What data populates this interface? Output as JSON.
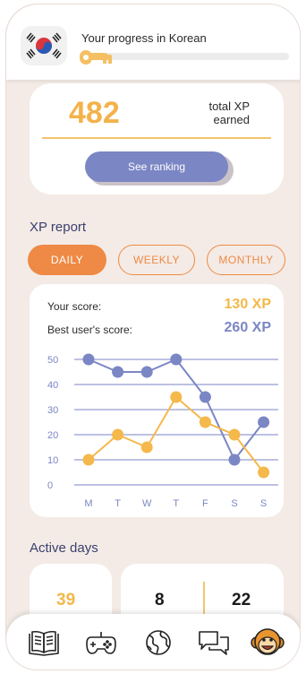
{
  "header": {
    "flag_icon": "south-korea-flag-icon",
    "progress_title": "Your progress in Korean",
    "progress_fraction": 0.13,
    "progress_color": "#f4c063",
    "key_icon": "key-icon"
  },
  "xp_summary": {
    "total_xp": "482",
    "label_line1": "total XP",
    "label_line2": "earned",
    "ranking_button": "See ranking"
  },
  "xp_report": {
    "title": "XP report",
    "tabs": [
      {
        "label": "DAILY",
        "active": true
      },
      {
        "label": "WEEKLY",
        "active": false
      },
      {
        "label": "MONTHLY",
        "active": false
      }
    ],
    "your_score_label": "Your score:",
    "your_score_value": "130 XP",
    "best_score_label": "Best user's score:",
    "best_score_value": "260 XP",
    "colors": {
      "you": "#f4b84b",
      "best": "#7b86c4"
    }
  },
  "chart_data": {
    "type": "line",
    "categories": [
      "M",
      "T",
      "W",
      "T",
      "F",
      "S",
      "S"
    ],
    "series": [
      {
        "values": [
          50,
          45,
          45,
          50,
          35,
          10,
          25
        ]
      },
      {
        "values": [
          10,
          20,
          15,
          35,
          25,
          20,
          5
        ]
      }
    ],
    "yticks": [
      0,
      10,
      20,
      30,
      40,
      50
    ],
    "ylim": [
      0,
      50
    ],
    "grid": true,
    "title": "",
    "xlabel": "",
    "ylabel": ""
  },
  "active_days": {
    "title": "Active days",
    "values": [
      "39",
      "8",
      "22"
    ]
  },
  "bottom_nav": {
    "items": [
      "book-icon",
      "gamepad-icon",
      "globe-icon",
      "chat-icon",
      "monkey-avatar-icon"
    ]
  }
}
